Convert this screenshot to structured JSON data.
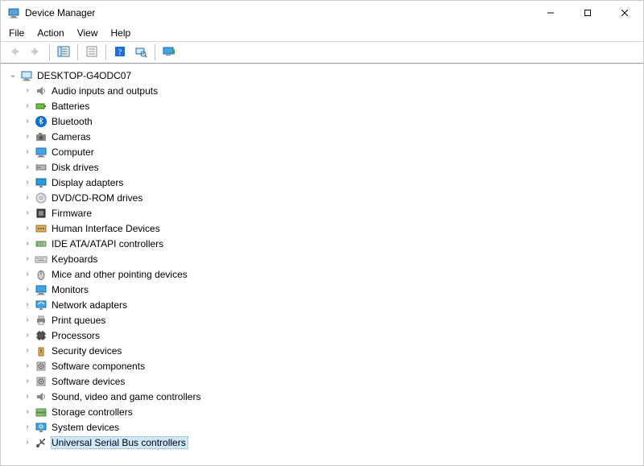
{
  "window": {
    "title": "Device Manager"
  },
  "menu": {
    "file": "File",
    "action": "Action",
    "view": "View",
    "help": "Help"
  },
  "tree": {
    "root": {
      "label": "DESKTOP-G4ODC07",
      "icon": "computer"
    },
    "items": [
      {
        "label": "Audio inputs and outputs",
        "icon": "speaker",
        "selected": false
      },
      {
        "label": "Batteries",
        "icon": "battery",
        "selected": false
      },
      {
        "label": "Bluetooth",
        "icon": "bluetooth",
        "selected": false
      },
      {
        "label": "Cameras",
        "icon": "camera",
        "selected": false
      },
      {
        "label": "Computer",
        "icon": "monitor",
        "selected": false
      },
      {
        "label": "Disk drives",
        "icon": "disk",
        "selected": false
      },
      {
        "label": "Display adapters",
        "icon": "display",
        "selected": false
      },
      {
        "label": "DVD/CD-ROM drives",
        "icon": "dvd",
        "selected": false
      },
      {
        "label": "Firmware",
        "icon": "firmware",
        "selected": false
      },
      {
        "label": "Human Interface Devices",
        "icon": "hid",
        "selected": false
      },
      {
        "label": "IDE ATA/ATAPI controllers",
        "icon": "ide",
        "selected": false
      },
      {
        "label": "Keyboards",
        "icon": "keyboard",
        "selected": false
      },
      {
        "label": "Mice and other pointing devices",
        "icon": "mouse",
        "selected": false
      },
      {
        "label": "Monitors",
        "icon": "monitor",
        "selected": false
      },
      {
        "label": "Network adapters",
        "icon": "network",
        "selected": false
      },
      {
        "label": "Print queues",
        "icon": "printer",
        "selected": false
      },
      {
        "label": "Processors",
        "icon": "cpu",
        "selected": false
      },
      {
        "label": "Security devices",
        "icon": "security",
        "selected": false
      },
      {
        "label": "Software components",
        "icon": "component",
        "selected": false
      },
      {
        "label": "Software devices",
        "icon": "component",
        "selected": false
      },
      {
        "label": "Sound, video and game controllers",
        "icon": "speaker",
        "selected": false
      },
      {
        "label": "Storage controllers",
        "icon": "storage",
        "selected": false
      },
      {
        "label": "System devices",
        "icon": "system",
        "selected": false
      },
      {
        "label": "Universal Serial Bus controllers",
        "icon": "usb",
        "selected": true
      }
    ]
  }
}
